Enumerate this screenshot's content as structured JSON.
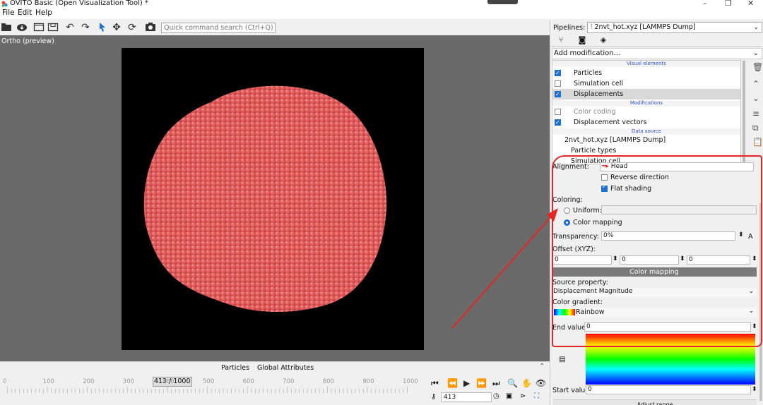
{
  "window": {
    "title": "OVITO Basic (Open Visualization Tool) *",
    "minimize": "–",
    "restore": "❐",
    "close": "✕"
  },
  "menu": {
    "file": "File",
    "edit": "Edit",
    "help": "Help"
  },
  "toolbar": {
    "search_placeholder": "Quick command search (Ctrl+Q)"
  },
  "viewport": {
    "label": "Ortho (preview)",
    "particle_color": "#e85a5a"
  },
  "bottom_tabs": {
    "particles": "Particles",
    "global_attributes": "Global Attributes"
  },
  "timeline": {
    "ticks": [
      "0",
      "100",
      "200",
      "300",
      "400",
      "500",
      "600",
      "700",
      "800",
      "900",
      "1000"
    ],
    "frame_display": "413 / 1000",
    "current_frame": "413",
    "total_frames": 1000
  },
  "pipeline": {
    "label": "Pipelines:",
    "selected": "2nvt_hot.xyz [LAMMPS Dump]",
    "add_modification": "Add modification...",
    "sections": {
      "visual": "Visual elements",
      "modifications": "Modifications",
      "data_source": "Data source"
    },
    "visual_elements": [
      {
        "label": "Particles",
        "checked": true
      },
      {
        "label": "Simulation cell",
        "checked": false
      },
      {
        "label": "Displacements",
        "checked": true
      }
    ],
    "modifications": [
      {
        "label": "Color coding",
        "checked": false
      },
      {
        "label": "Displacement vectors",
        "checked": true
      }
    ],
    "data_source_items": [
      "2nvt_hot.xyz [LAMMPS Dump]",
      "Particle types",
      "Simulation cell"
    ]
  },
  "properties": {
    "alignment_label": "Alignment:",
    "alignment_value": "Head",
    "reverse_direction": "Reverse direction",
    "flat_shading": "Flat shading",
    "coloring_label": "Coloring:",
    "uniform": "Uniform:",
    "color_mapping": "Color mapping",
    "transparency_label": "Transparency:",
    "transparency_value": "0%",
    "offset_label": "Offset (XYZ):",
    "offset_x": "0",
    "offset_y": "0",
    "offset_z": "0",
    "cm_header": "Color mapping",
    "source_property_label": "Source property:",
    "source_property_value": "Displacement Magnitude",
    "color_gradient_label": "Color gradient:",
    "color_gradient_value": "Rainbow",
    "end_value_label": "End value:",
    "end_value": "0",
    "start_value_label": "Start value:",
    "start_value": "0",
    "adjust_label": "Adjust range"
  },
  "colors": {
    "annotation": "#e52525",
    "accent": "#1e6fd0"
  }
}
